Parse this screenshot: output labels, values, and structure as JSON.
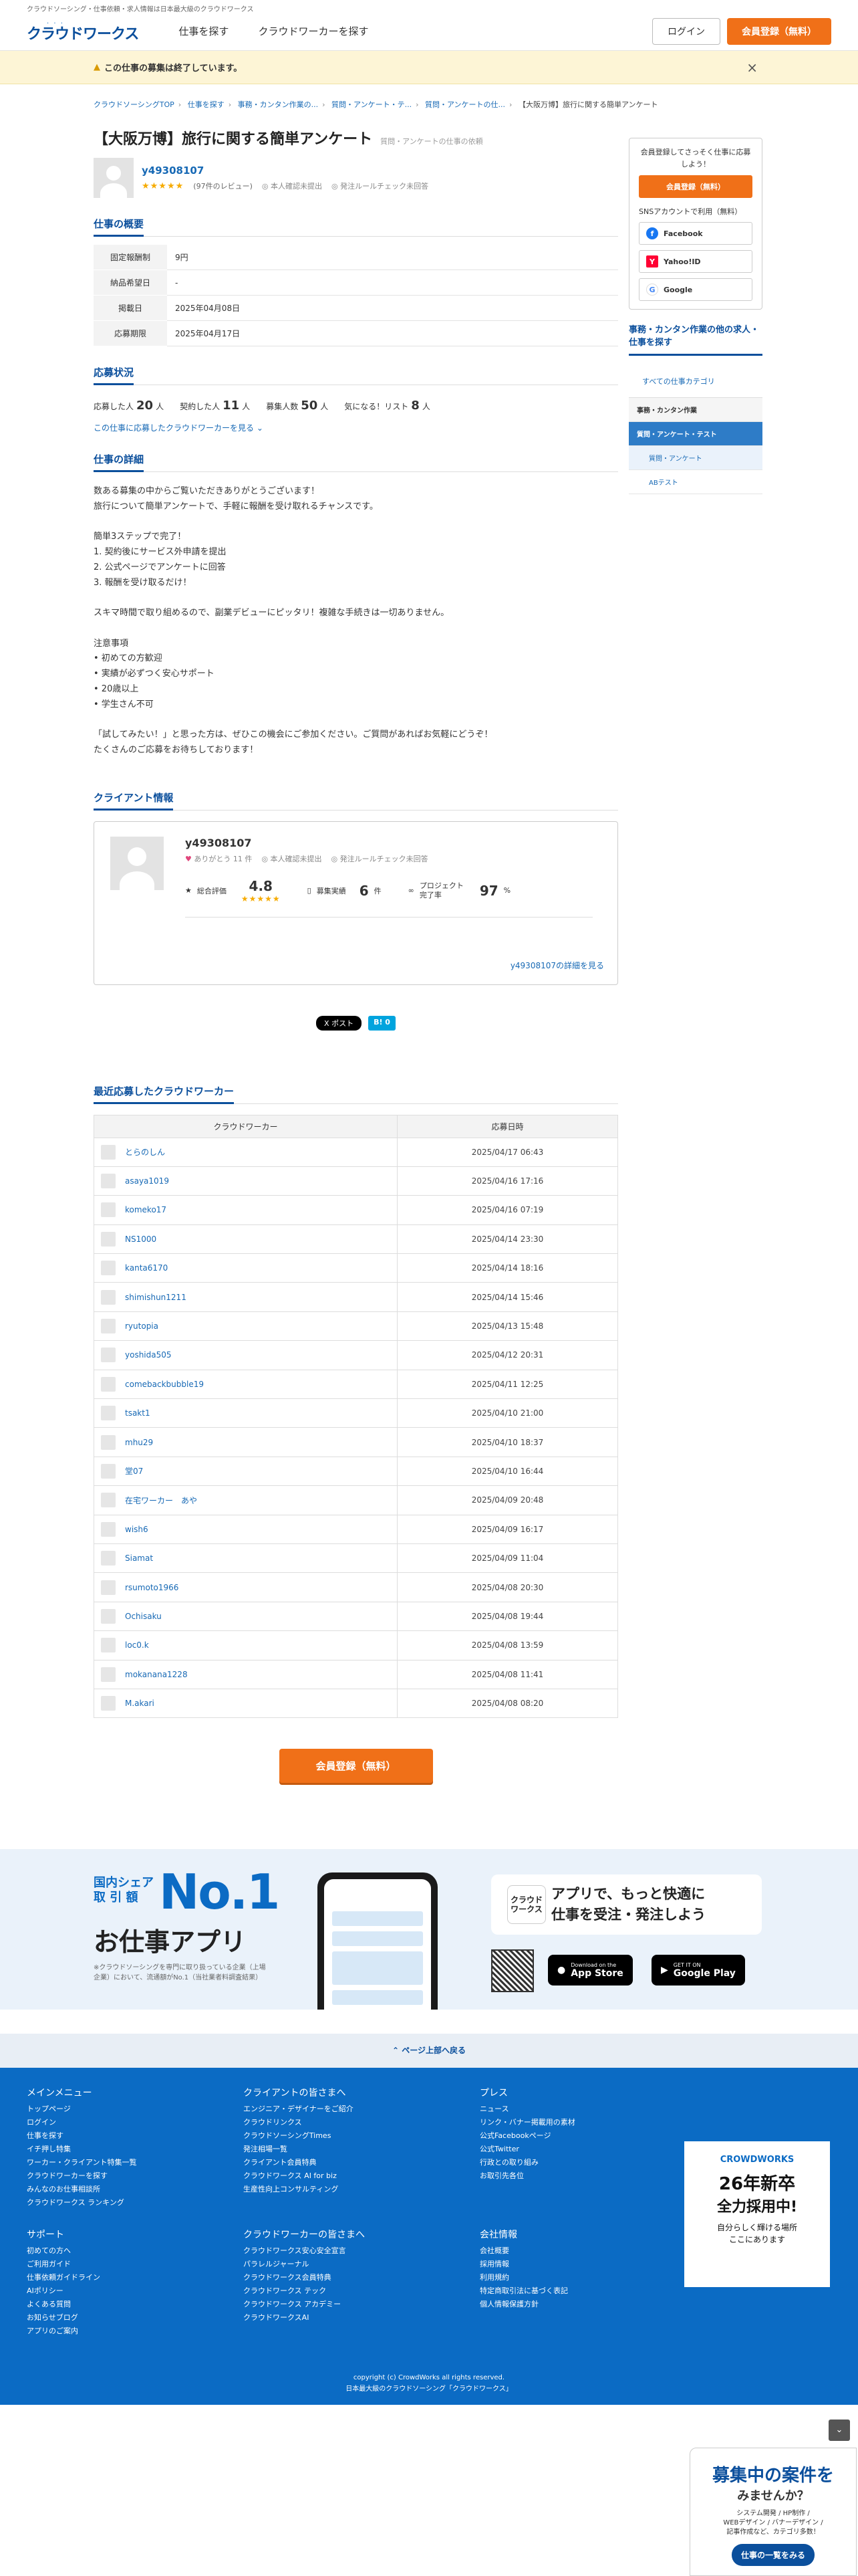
{
  "header": {
    "topline": "クラウドソーシング・仕事依頼・求人情報は日本最大級のクラウドワークス",
    "logo": "クラウドワークス",
    "nav": [
      "仕事を探す",
      "クラウドワーカーを探す"
    ],
    "login": "ログイン",
    "register": "会員登録（無料）"
  },
  "alert": {
    "text": "この仕事の募集は終了しています。",
    "close": "×"
  },
  "breadcrumb": [
    "クラウドソーシングTOP",
    "仕事を探す",
    "事務・カンタン作業の...",
    "質問・アンケート・テ...",
    "質問・アンケートの仕...",
    "【大阪万博】旅行に関する簡単アンケート"
  ],
  "job": {
    "title": "【大阪万博】旅行に関する簡単アンケート",
    "subtitle": "質問・アンケートの仕事の依頼",
    "user": "y49308107",
    "stars": "★★★★★",
    "reviews": "(97件のレビュー)",
    "identity": "本人確認未提出",
    "rules": "発注ルールチェック未回答"
  },
  "overview": {
    "heading": "仕事の概要",
    "rows": [
      {
        "k": "固定報酬制",
        "v": "9円"
      },
      {
        "k": "納品希望日",
        "v": "-"
      },
      {
        "k": "掲載日",
        "v": "2025年04月08日"
      },
      {
        "k": "応募期限",
        "v": "2025年04月17日"
      }
    ]
  },
  "status": {
    "heading": "応募状況",
    "items": [
      {
        "k": "応募した人",
        "v": "20",
        "u": "人"
      },
      {
        "k": "契約した人",
        "v": "11",
        "u": "人"
      },
      {
        "k": "募集人数",
        "v": "50",
        "u": "人"
      },
      {
        "k": "気になる！リスト",
        "v": "8",
        "u": "人"
      }
    ],
    "link": "この仕事に応募したクラウドワーカーを見る ⌄"
  },
  "detail": {
    "heading": "仕事の詳細",
    "body": "数ある募集の中からご覧いただきありがとうございます！\n旅行について簡単アンケートで、手軽に報酬を受け取れるチャンスです。\n\n簡単3ステップで完了！\n1. 契約後にサービス外申請を提出\n2. 公式ページでアンケートに回答\n3. 報酬を受け取るだけ！\n\nスキマ時間で取り組めるので、副業デビューにピッタリ！複雑な手続きは一切ありません。\n\n注意事項\n• 初めての方歓迎\n• 実績が必ずつく安心サポート\n• 20歳以上\n• 学生さん不可\n\n「試してみたい！」と思った方は、ぜひこの機会にご参加ください。ご質問があればお気軽にどうぞ！\nたくさんのご応募をお待ちしております！"
  },
  "client": {
    "heading": "クライアント情報",
    "name": "y49308107",
    "thanks": "ありがとう 11 件",
    "identity": "本人確認未提出",
    "rules": "発注ルールチェック未回答",
    "rating_label": "総合評価",
    "rating": "4.8",
    "stars": "★★★★★",
    "jobs_label": "募集実績",
    "jobs": "6",
    "jobs_unit": "件",
    "rate_label": "プロジェクト完了率",
    "rate": "97",
    "rate_unit": "%",
    "more": "y49308107の詳細を見る"
  },
  "share": {
    "x": "X ポスト",
    "hatena": "B! 0"
  },
  "applicants": {
    "heading": "最近応募したクラウドワーカー",
    "col1": "クラウドワーカー",
    "col2": "応募日時",
    "rows": [
      [
        "とらのしん",
        "2025/04/17 06:43"
      ],
      [
        "asaya1019",
        "2025/04/16 17:16"
      ],
      [
        "komeko17",
        "2025/04/16 07:19"
      ],
      [
        "NS1000",
        "2025/04/14 23:30"
      ],
      [
        "kanta6170",
        "2025/04/14 18:16"
      ],
      [
        "shimishun1211",
        "2025/04/14 15:46"
      ],
      [
        "ryutopia",
        "2025/04/13 15:48"
      ],
      [
        "yoshida505",
        "2025/04/12 20:31"
      ],
      [
        "comebackbubble19",
        "2025/04/11 12:25"
      ],
      [
        "tsakt1",
        "2025/04/10 21:00"
      ],
      [
        "mhu29",
        "2025/04/10 18:37"
      ],
      [
        "堂07",
        "2025/04/10 16:44"
      ],
      [
        "在宅ワーカー　あや",
        "2025/04/09 20:48"
      ],
      [
        "wish6",
        "2025/04/09 16:17"
      ],
      [
        "Siamat",
        "2025/04/09 11:04"
      ],
      [
        "rsumoto1966",
        "2025/04/08 20:30"
      ],
      [
        "Ochisaku",
        "2025/04/08 19:44"
      ],
      [
        "loc0.k",
        "2025/04/08 13:59"
      ],
      [
        "mokanana1228",
        "2025/04/08 11:41"
      ],
      [
        "M.akari",
        "2025/04/08 08:20"
      ]
    ]
  },
  "bottom_register": "会員登録（無料）",
  "sidebar": {
    "promo": "会員登録してさっそく仕事に応募しよう！",
    "register": "会員登録（無料）",
    "sns_label": "SNSアカウントで利用（無料）",
    "sns": [
      "Facebook",
      "Yahoo!ID",
      "Google"
    ],
    "cat_heading": "事務・カンタン作業の他の求人・仕事を探す",
    "all": "すべての仕事カテゴリ",
    "cats": [
      "事務・カンタン作業",
      "質問・アンケート・テスト",
      "質問・アンケート",
      "ABテスト"
    ]
  },
  "banner": {
    "share": "国内シェア\n取 引 額",
    "no1": "No.1",
    "app": "お仕事アプリ",
    "note": "※クラウドソーシングを専門に取り扱っている企業（上場企業）において、流通額がNo.1（当社業者料調査結果）",
    "bubble": "アプリで、もっと快適に\n仕事を受注・発注しよう",
    "logo": "クラウド\nワークス",
    "appstore_small": "Download on the",
    "appstore": "App Store",
    "googleplay_small": "GET IT ON",
    "googleplay": "Google Play"
  },
  "pagetop": "⌃ ページ上部へ戻る",
  "footer": {
    "cols": [
      {
        "h": "メインメニュー",
        "items": [
          "トップページ",
          "ログイン",
          "仕事を探す",
          "イチ押し特集",
          "ワーカー・クライアント特集一覧",
          "クラウドワーカーを探す",
          "みんなのお仕事相談所",
          "クラウドワークス ランキング"
        ]
      },
      {
        "h": "クライアントの皆さまへ",
        "items": [
          "エンジニア・デザイナーをご紹介",
          "クラウドリンクス",
          "クラウドソーシングTimes",
          "発注相場一覧",
          "クライアント会員特典",
          "クラウドワークス AI for biz",
          "生産性向上コンサルティング"
        ]
      },
      {
        "h": "プレス",
        "items": [
          "ニュース",
          "リンク・バナー掲載用の素材",
          "公式Facebookページ",
          "公式Twitter",
          "行政との取り組み",
          "お取引先各位"
        ]
      },
      {
        "h": "サポート",
        "items": [
          "初めての方へ",
          "ご利用ガイド",
          "仕事依頼ガイドライン",
          "AIポリシー",
          "よくある質問",
          "お知らせブログ",
          "アプリのご案内"
        ]
      },
      {
        "h": "クラウドワーカーの皆さまへ",
        "items": [
          "クラウドワークス安心安全宣言",
          "パラレルジャーナル",
          "クラウドワークス会員特典",
          "クラウドワークス テック",
          "クラウドワークス アカデミー",
          "クラウドワークスAI"
        ]
      },
      {
        "h": "会社情報",
        "items": [
          "会社概要",
          "採用情報",
          "利用規約",
          "特定商取引法に基づく表記",
          "個人情報保護方針"
        ]
      }
    ],
    "ad_brand": "CROWDWORKS",
    "ad_title": "26年新卒",
    "ad_sub": "全力採用中!",
    "ad_text": "自分らしく輝ける場所\nここにあります",
    "copyright": "copyright (c) CrowdWorks all rights reserved.",
    "tagline": "日本最大級のクラウドソーシング「クラウドワークス」"
  },
  "float": {
    "l1": "募集中の案件を",
    "l2": "みませんか？",
    "l3": "システム開発 / HP制作 /\nWEBデザイン / バナーデザイン /\n記事作成など、カテゴリ多数！",
    "btn": "仕事の一覧をみる"
  }
}
